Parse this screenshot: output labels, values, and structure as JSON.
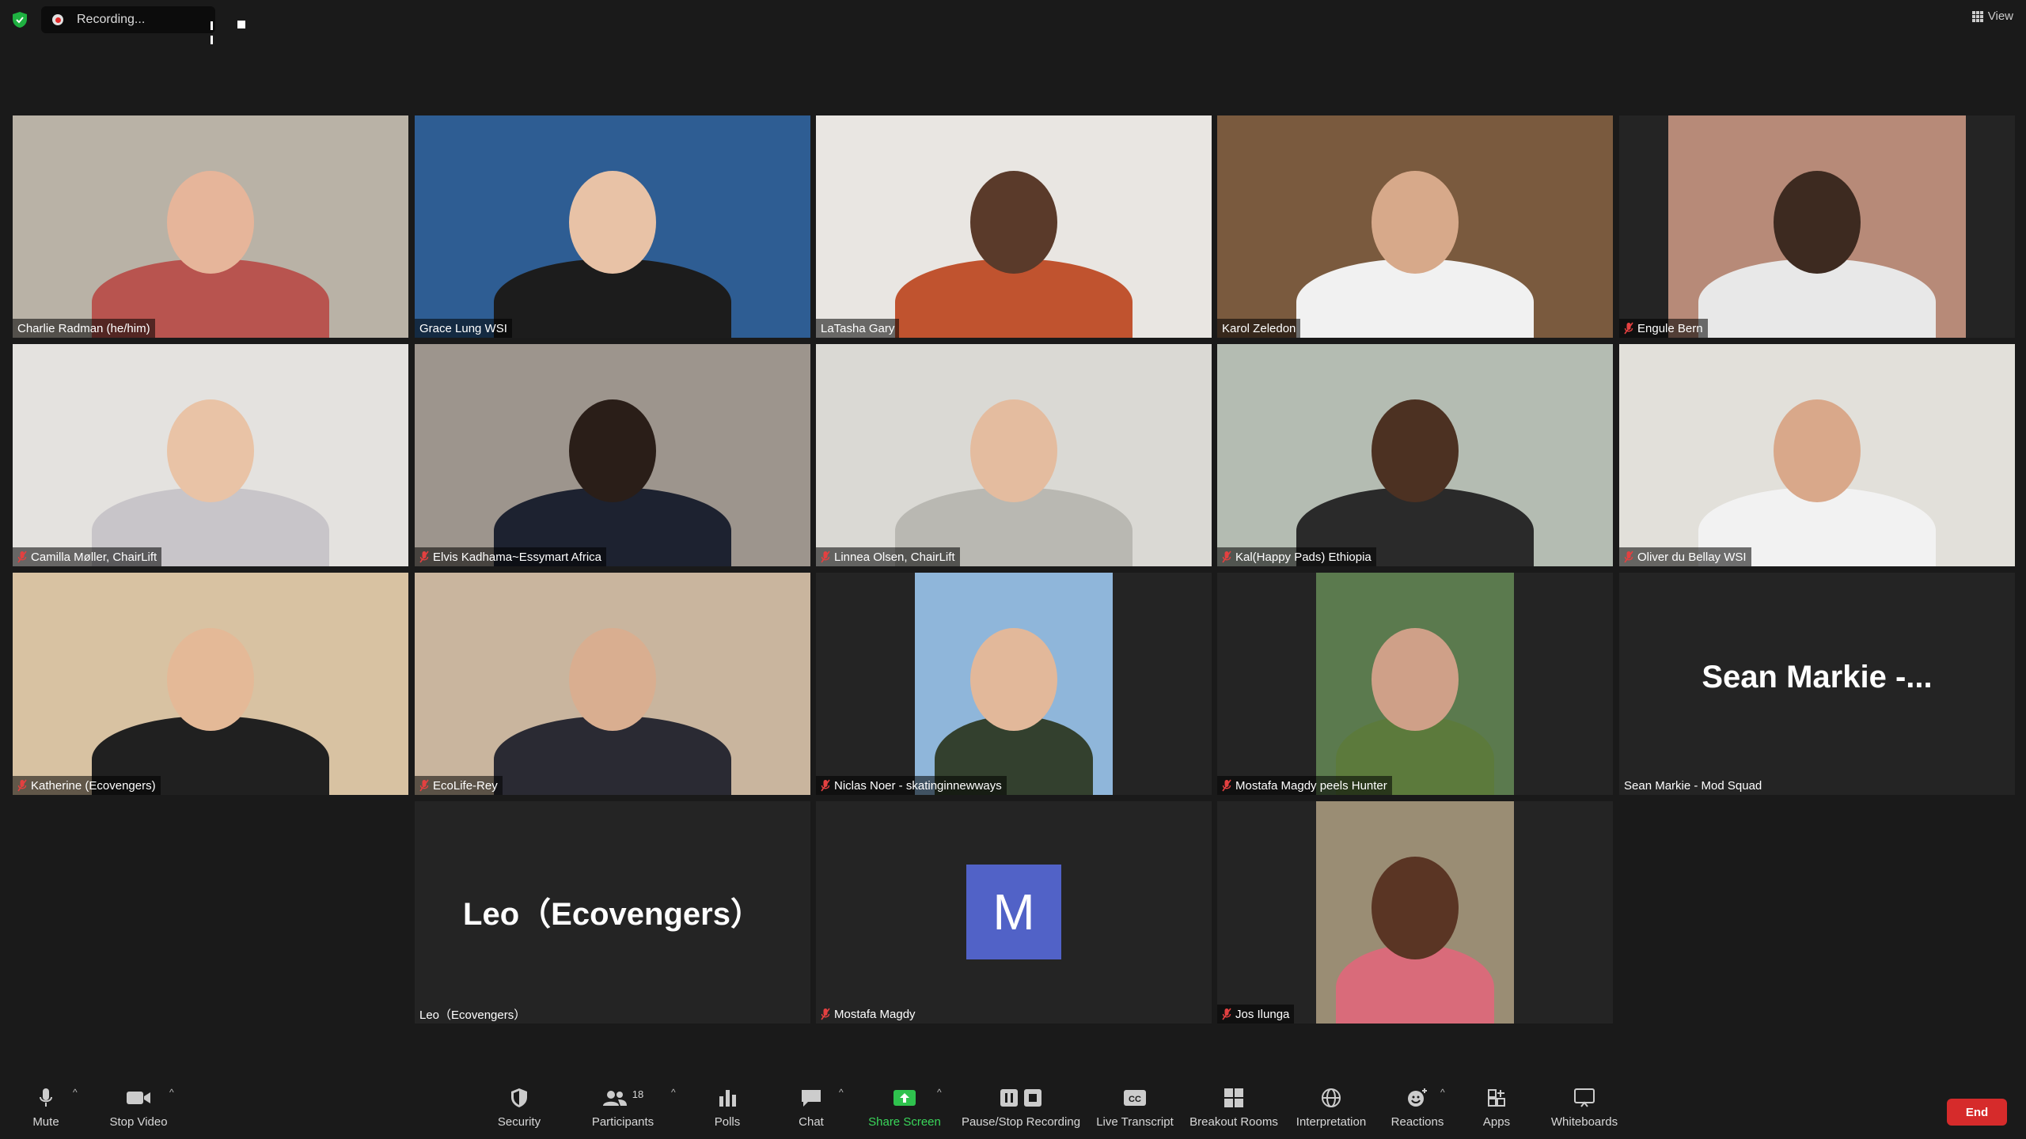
{
  "recording": {
    "label": "Recording..."
  },
  "view_button": {
    "label": "View"
  },
  "tiles": [
    {
      "name": "Charlie Radman (he/him)",
      "muted": false,
      "bg": "#b9b2a6",
      "skin": "#e6b59a",
      "shirt": "#b8544f"
    },
    {
      "name": "Grace Lung WSI",
      "muted": false,
      "active": true,
      "bg": "#2e5d93",
      "skin": "#e8c2a6",
      "shirt": "#1c1c1c"
    },
    {
      "name": "LaTasha Gary",
      "muted": false,
      "bg": "#e9e6e2",
      "skin": "#5a3a2a",
      "shirt": "#c0532f"
    },
    {
      "name": "Karol Zeledon",
      "muted": false,
      "bg": "#7a5a3e",
      "skin": "#d7a98a",
      "shirt": "#f1f1f1"
    },
    {
      "name": "Engule Bern",
      "muted": true,
      "bg": "#b78a78",
      "skin": "#3d2a20",
      "shirt": "#e8e8e8"
    },
    {
      "name": "Camilla Møller, ChairLift",
      "muted": true,
      "bg": "#e4e2df",
      "skin": "#e9c3a6",
      "shirt": "#c8c5c9"
    },
    {
      "name": "Elvis Kadhama~Essymart Africa",
      "muted": true,
      "bg": "#9d958d",
      "skin": "#2a1e18",
      "shirt": "#1d2230"
    },
    {
      "name": "Linnea Olsen, ChairLift",
      "muted": true,
      "bg": "#dad9d4",
      "skin": "#e4bc9f",
      "shirt": "#b9b8b2"
    },
    {
      "name": "Kal(Happy Pads) Ethiopia",
      "muted": true,
      "bg": "#b4bcb2",
      "skin": "#4c3122",
      "shirt": "#2a2a2a"
    },
    {
      "name": "Oliver du Bellay WSI",
      "muted": true,
      "bg": "#e2e0da",
      "skin": "#d9a88a",
      "shirt": "#f2f2f2"
    },
    {
      "name": "Katherine (Ecovengers)",
      "muted": true,
      "bg": "#d8c2a2",
      "skin": "#e4b997",
      "shirt": "#202020"
    },
    {
      "name": "EcoLife-Rey",
      "muted": true,
      "bg": "#c9b59e",
      "skin": "#d9ae90",
      "shirt": "#2a2a33"
    },
    {
      "name": "Niclas Noer - skatinginnewways",
      "muted": true,
      "bg": "#8fb6da",
      "skin": "#e2b89a",
      "shirt": "#33402e",
      "narrow": true
    },
    {
      "name": "Mostafa Magdy peels Hunter",
      "muted": true,
      "bg": "#5b7a4e",
      "skin": "#cfa088",
      "shirt": "#5c7a3c",
      "narrow": true
    },
    {
      "name": "Sean Markie - Mod Squad",
      "muted": false,
      "no_video": true,
      "display_name": "Sean Markie -..."
    },
    {
      "name": "Leo（Ecovengers）",
      "muted": false,
      "no_video": true,
      "display_name": "Leo（Ecovengers）"
    },
    {
      "name": "Mostafa Magdy",
      "muted": true,
      "no_video": true,
      "avatar_letter": "M"
    },
    {
      "name": "Jos Ilunga",
      "muted": true,
      "bg": "#9a8d74",
      "skin": "#5a3524",
      "shirt": "#d96b7a",
      "narrow": true
    }
  ],
  "toolbar": {
    "mute": "Mute",
    "stop_video": "Stop Video",
    "security": "Security",
    "participants": "Participants",
    "participants_count": "18",
    "polls": "Polls",
    "chat": "Chat",
    "share_screen": "Share Screen",
    "pause_stop_recording": "Pause/Stop Recording",
    "live_transcript": "Live Transcript",
    "breakout_rooms": "Breakout Rooms",
    "interpretation": "Interpretation",
    "reactions": "Reactions",
    "apps": "Apps",
    "whiteboards": "Whiteboards",
    "end": "End"
  },
  "colors": {
    "accent_green": "#3ad65a",
    "end_red": "#d62b2b",
    "active_speaker": "#d6e35a",
    "avatar_blue": "#5162c7"
  }
}
